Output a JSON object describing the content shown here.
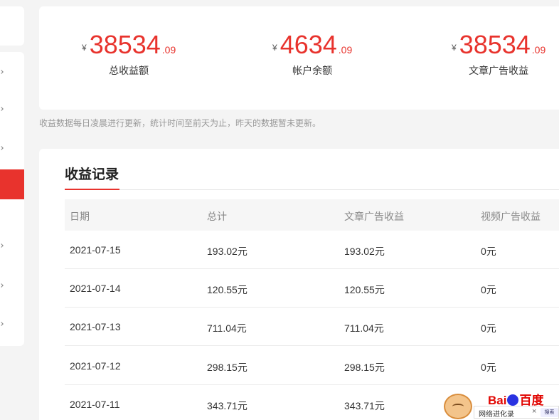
{
  "stats": [
    {
      "currency": "¥",
      "integer": "38534",
      "decimal": ".09",
      "label": "总收益额"
    },
    {
      "currency": "¥",
      "integer": "4634",
      "decimal": ".09",
      "label": "帐户余额"
    },
    {
      "currency": "¥",
      "integer": "38534",
      "decimal": ".09",
      "label": "文章广告收益"
    }
  ],
  "note": "收益数据每日凌晨进行更新，统计时间至前天为止，昨天的数据暂未更新。",
  "records": {
    "title": "收益记录",
    "columns": [
      "日期",
      "总计",
      "文章广告收益",
      "视频广告收益"
    ],
    "rows": [
      [
        "2021-07-15",
        "193.02元",
        "193.02元",
        "0元"
      ],
      [
        "2021-07-14",
        "120.55元",
        "120.55元",
        "0元"
      ],
      [
        "2021-07-13",
        "711.04元",
        "711.04元",
        "0元"
      ],
      [
        "2021-07-12",
        "298.15元",
        "298.15元",
        "0元"
      ],
      [
        "2021-07-11",
        "343.71元",
        "343.71元",
        ""
      ]
    ]
  },
  "baidu_widget": {
    "logo_left": "Bai",
    "logo_right": "百度",
    "text": "网络进化录",
    "close": "×",
    "search": "搜索"
  },
  "colors": {
    "accent": "#e8332d",
    "baidu_red": "#e10602",
    "baidu_blue": "#2932e1"
  }
}
